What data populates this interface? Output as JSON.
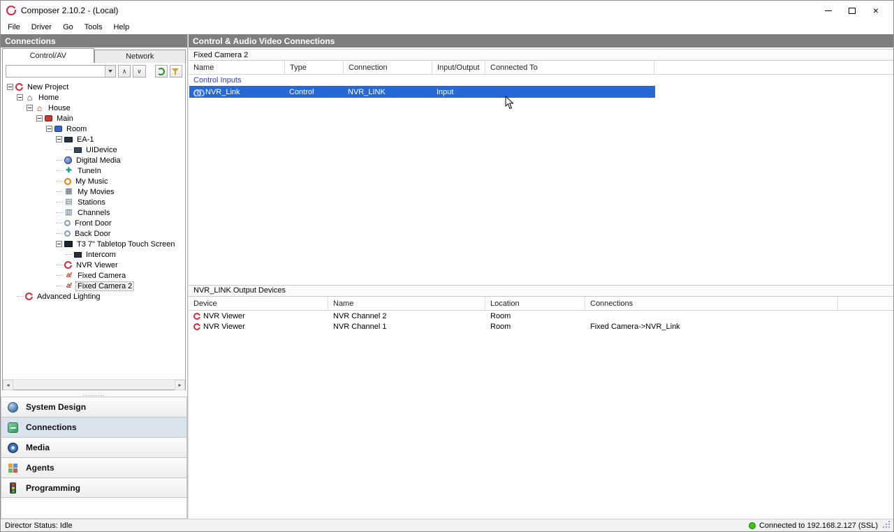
{
  "window": {
    "title": "Composer 2.10.2 - (Local)"
  },
  "menu": {
    "items": [
      "File",
      "Driver",
      "Go",
      "Tools",
      "Help"
    ]
  },
  "sidebar": {
    "title": "Connections",
    "tabs": [
      {
        "label": "Control/AV",
        "active": true
      },
      {
        "label": "Network",
        "active": false
      }
    ],
    "search": {
      "value": "",
      "placeholder": ""
    },
    "tree": [
      {
        "depth": 0,
        "label": "New Project",
        "icon": "control4-logo-icon",
        "expandable": true,
        "selected": false
      },
      {
        "depth": 1,
        "label": "Home",
        "icon": "home-icon",
        "expandable": true,
        "selected": false
      },
      {
        "depth": 2,
        "label": "House",
        "icon": "house-icon",
        "expandable": true,
        "selected": false
      },
      {
        "depth": 3,
        "label": "Main",
        "icon": "main-room-icon",
        "expandable": true,
        "selected": false
      },
      {
        "depth": 4,
        "label": "Room",
        "icon": "room-icon",
        "expandable": true,
        "selected": false
      },
      {
        "depth": 5,
        "label": "EA-1",
        "icon": "ea1-controller-icon",
        "expandable": true,
        "selected": false
      },
      {
        "depth": 6,
        "label": "UIDevice",
        "icon": "uidevice-icon",
        "expandable": false,
        "selected": false
      },
      {
        "depth": 5,
        "label": "Digital Media",
        "icon": "digital-media-icon",
        "expandable": false,
        "selected": false
      },
      {
        "depth": 5,
        "label": "TuneIn",
        "icon": "tunein-icon",
        "expandable": false,
        "selected": false
      },
      {
        "depth": 5,
        "label": "My Music",
        "icon": "my-music-icon",
        "expandable": false,
        "selected": false
      },
      {
        "depth": 5,
        "label": "My Movies",
        "icon": "my-movies-icon",
        "expandable": false,
        "selected": false
      },
      {
        "depth": 5,
        "label": "Stations",
        "icon": "stations-icon",
        "expandable": false,
        "selected": false
      },
      {
        "depth": 5,
        "label": "Channels",
        "icon": "channels-icon",
        "expandable": false,
        "selected": false
      },
      {
        "depth": 5,
        "label": "Front Door",
        "icon": "front-door-icon",
        "expandable": false,
        "selected": false
      },
      {
        "depth": 5,
        "label": "Back Door",
        "icon": "back-door-icon",
        "expandable": false,
        "selected": false
      },
      {
        "depth": 5,
        "label": "T3 7\" Tabletop Touch Screen",
        "icon": "touchscreen-icon",
        "expandable": true,
        "selected": false
      },
      {
        "depth": 6,
        "label": "Intercom",
        "icon": "intercom-icon",
        "expandable": false,
        "selected": false
      },
      {
        "depth": 5,
        "label": "NVR Viewer",
        "icon": "nvr-viewer-icon",
        "expandable": false,
        "selected": false
      },
      {
        "depth": 5,
        "label": "Fixed Camera",
        "icon": "camera-icon",
        "expandable": false,
        "selected": false
      },
      {
        "depth": 5,
        "label": "Fixed Camera 2",
        "icon": "camera-icon",
        "expandable": false,
        "selected": true
      },
      {
        "depth": 1,
        "label": "Advanced Lighting",
        "icon": "advanced-lighting-icon",
        "expandable": false,
        "selected": false
      }
    ],
    "nav": [
      {
        "label": "System Design",
        "icon": "system-design-icon",
        "active": false
      },
      {
        "label": "Connections",
        "icon": "connections-icon",
        "active": true
      },
      {
        "label": "Media",
        "icon": "media-icon",
        "active": false
      },
      {
        "label": "Agents",
        "icon": "agents-icon",
        "active": false
      },
      {
        "label": "Programming",
        "icon": "programming-icon",
        "active": false
      }
    ]
  },
  "main": {
    "title": "Control & Audio Video Connections",
    "caption": "Fixed Camera 2",
    "columns": [
      "Name",
      "Type",
      "Connection",
      "Input/Output",
      "Connected To"
    ],
    "group_label": "Control Inputs",
    "rows": [
      {
        "name": "NVR_Link",
        "type": "Control",
        "connection": "NVR_LINK",
        "io": "Input",
        "connected_to": "",
        "selected": true
      }
    ],
    "output": {
      "caption": "NVR_LINK Output Devices",
      "columns": [
        "Device",
        "Name",
        "Location",
        "Connections"
      ],
      "rows": [
        {
          "device": "NVR Viewer",
          "name": "NVR Channel 2",
          "location": "Room",
          "connections": ""
        },
        {
          "device": "NVR Viewer",
          "name": "NVR Channel 1",
          "location": "Room",
          "connections": "Fixed Camera->NVR_Link"
        }
      ]
    }
  },
  "statusbar": {
    "left": "Director Status: Idle",
    "right": "Connected to 192.168.2.127 (SSL)"
  }
}
